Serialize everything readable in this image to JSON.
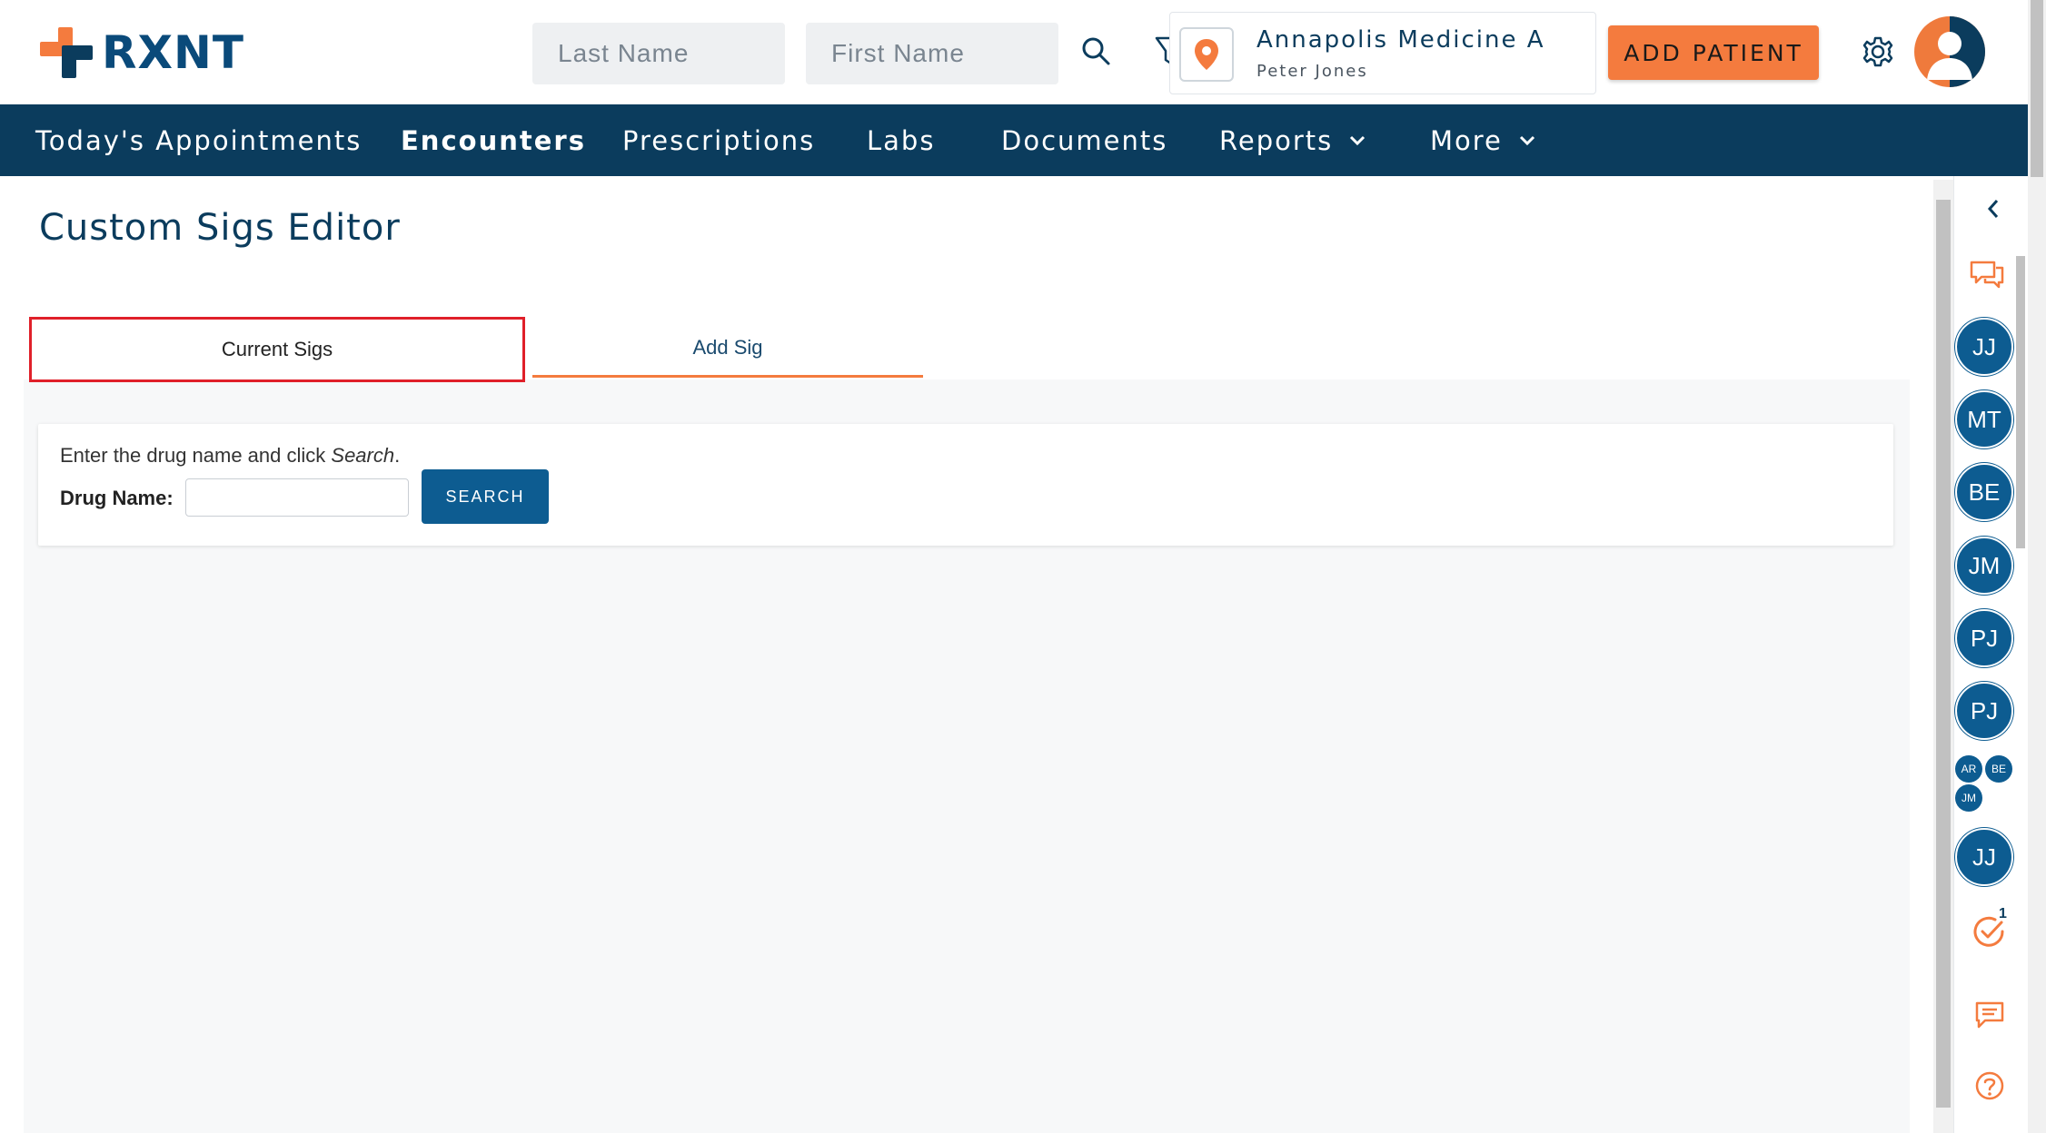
{
  "header": {
    "logo_text": "RXNT",
    "last_name_placeholder": "Last Name",
    "first_name_placeholder": "First Name",
    "location_name": "Annapolis Medicine A",
    "provider_name": "Peter Jones",
    "add_patient_label": "ADD PATIENT"
  },
  "nav": {
    "items": [
      {
        "label": "Today's Appointments"
      },
      {
        "label": "Encounters"
      },
      {
        "label": "Prescriptions"
      },
      {
        "label": "Labs"
      },
      {
        "label": "Documents"
      },
      {
        "label": "Reports"
      },
      {
        "label": "More"
      }
    ],
    "active_index": 1
  },
  "page": {
    "title": "Custom Sigs Editor",
    "tabs": [
      {
        "label": "Current Sigs"
      },
      {
        "label": "Add Sig"
      }
    ],
    "search_hint_prefix": "Enter the drug name and click ",
    "search_hint_emph": "Search",
    "search_hint_suffix": ".",
    "drug_name_label": "Drug Name:",
    "drug_name_value": "",
    "search_button": "SEARCH"
  },
  "sidebar": {
    "users": [
      "JJ",
      "MT",
      "BE",
      "JM",
      "PJ",
      "PJ"
    ],
    "group": [
      "AR",
      "BE",
      "JM"
    ],
    "last_user": "JJ",
    "tasks_badge": "1"
  },
  "colors": {
    "brand_navy": "#0b3c5d",
    "accent_orange": "#f47b3e",
    "button_blue": "#0d5c91",
    "highlight_red": "#e0202a"
  }
}
